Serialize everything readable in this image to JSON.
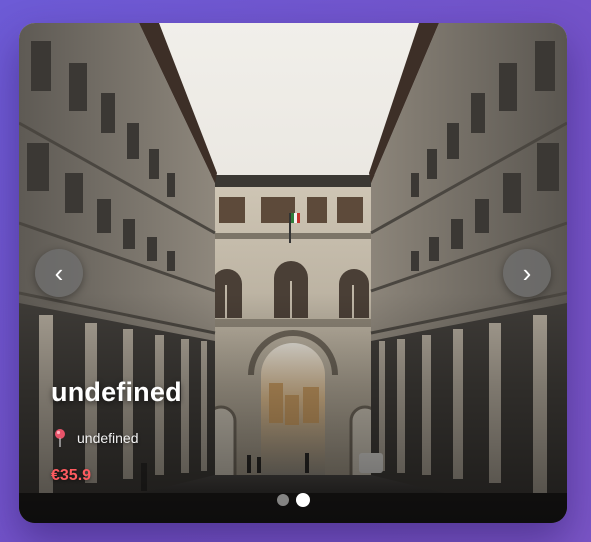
{
  "card": {
    "title": "undefined",
    "location": "undefined",
    "price": "€35.9",
    "location_icon": "pin-icon",
    "image": "photo of a courtyard flanked by tall stone arcaded buildings with an arched gateway at the far end under a cloudy sky"
  },
  "carousel": {
    "prev_label": "‹",
    "next_label": "›",
    "prev_icon": "chevron-left-icon",
    "next_icon": "chevron-right-icon",
    "slides_total": 2,
    "active_slide": 2
  },
  "colors": {
    "background_start": "#6d5bd6",
    "background_end": "#7a55c6",
    "price": "#ff5b60",
    "title": "#ffffff",
    "nav_button": "#6e6e6e"
  }
}
